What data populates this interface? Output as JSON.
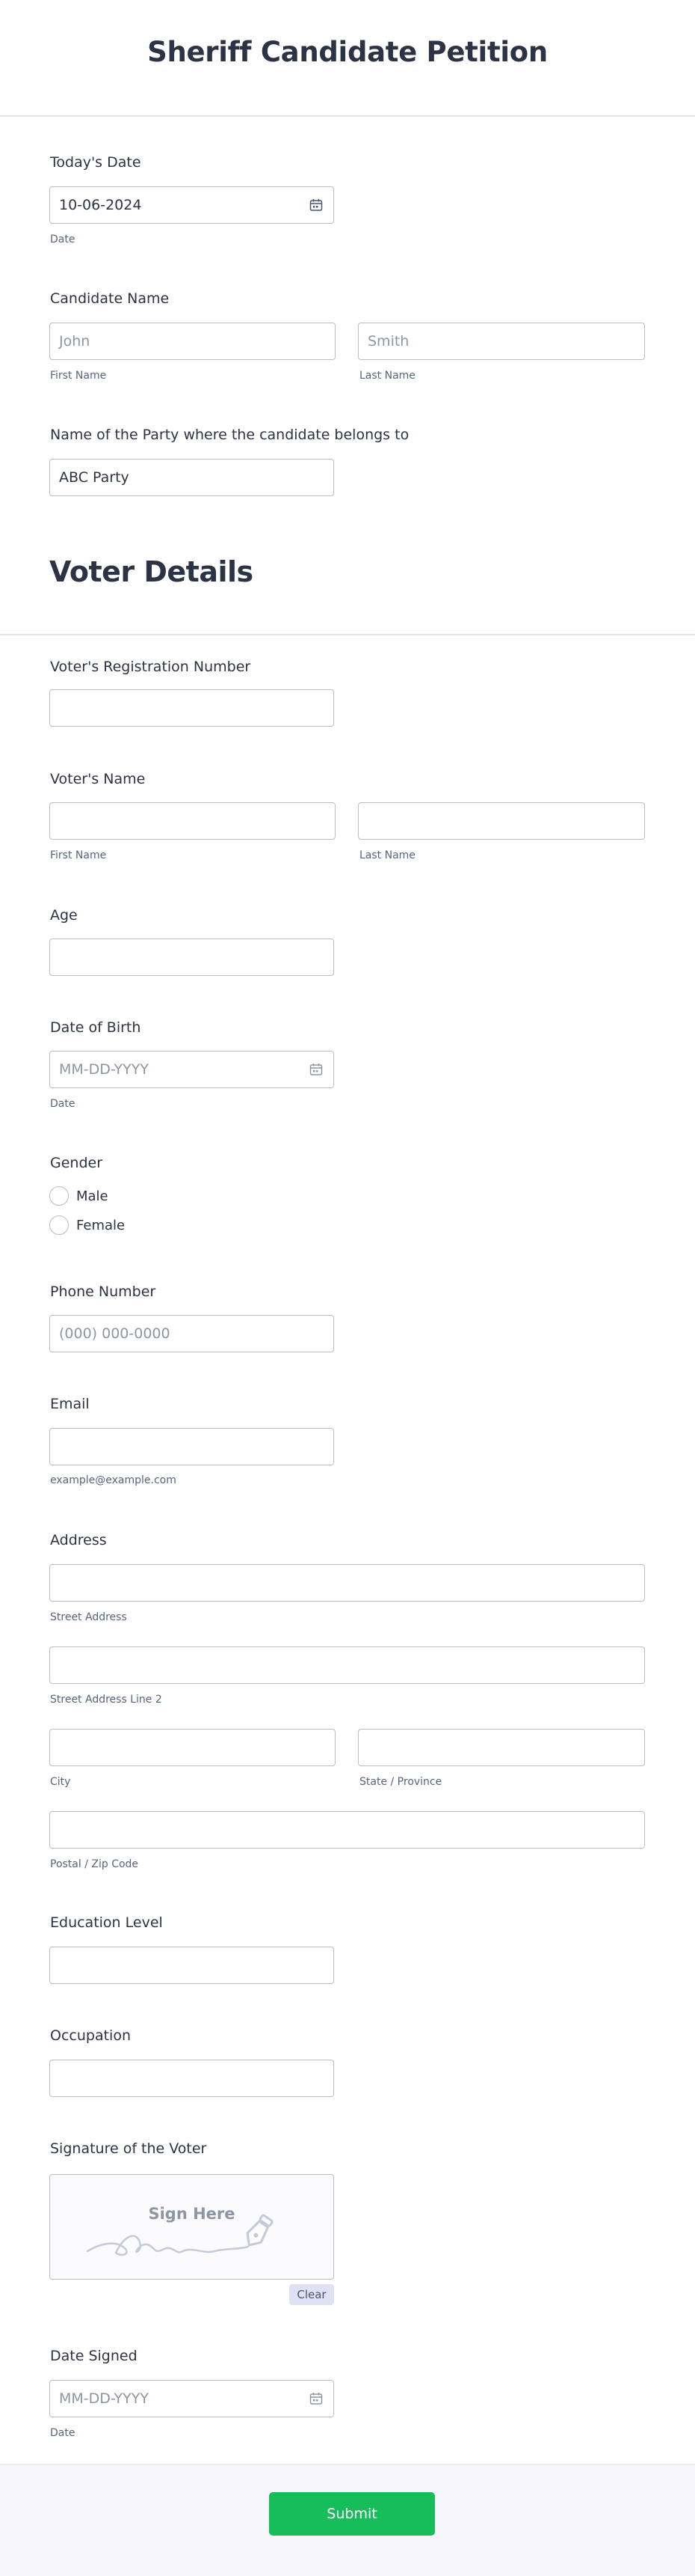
{
  "form": {
    "title": "Sheriff Candidate Petition",
    "todays_date": {
      "label": "Today's Date",
      "value": "10-06-2024",
      "sublabel": "Date"
    },
    "candidate_name": {
      "label": "Candidate Name",
      "first_placeholder": "John",
      "first_sublabel": "First Name",
      "last_placeholder": "Smith",
      "last_sublabel": "Last Name"
    },
    "party": {
      "label": "Name of the Party where the candidate belongs to",
      "value": "ABC Party"
    },
    "voter_section_title": "Voter Details",
    "voter_reg": {
      "label": "Voter's Registration Number",
      "value": ""
    },
    "voter_name": {
      "label": "Voter's Name",
      "first_sublabel": "First Name",
      "last_sublabel": "Last Name"
    },
    "age": {
      "label": "Age"
    },
    "dob": {
      "label": "Date of Birth",
      "placeholder": "MM-DD-YYYY",
      "sublabel": "Date"
    },
    "gender": {
      "label": "Gender",
      "options": [
        "Male",
        "Female"
      ]
    },
    "phone": {
      "label": "Phone Number",
      "placeholder": "(000) 000-0000"
    },
    "email": {
      "label": "Email",
      "sublabel": "example@example.com"
    },
    "address": {
      "label": "Address",
      "street_sublabel": "Street Address",
      "street2_sublabel": "Street Address Line 2",
      "city_sublabel": "City",
      "state_sublabel": "State / Province",
      "zip_sublabel": "Postal / Zip Code"
    },
    "education": {
      "label": "Education Level"
    },
    "occupation": {
      "label": "Occupation"
    },
    "signature": {
      "label": "Signature of the Voter",
      "hint": "Sign Here",
      "clear_label": "Clear"
    },
    "date_signed": {
      "label": "Date Signed",
      "placeholder": "MM-DD-YYYY",
      "sublabel": "Date"
    },
    "submit_label": "Submit"
  },
  "colors": {
    "accent_submit": "#18bd5b",
    "text_primary": "#2c3345",
    "border": "#b8bdc9"
  },
  "icons": [
    "calendar-icon",
    "signature-pen-icon"
  ]
}
